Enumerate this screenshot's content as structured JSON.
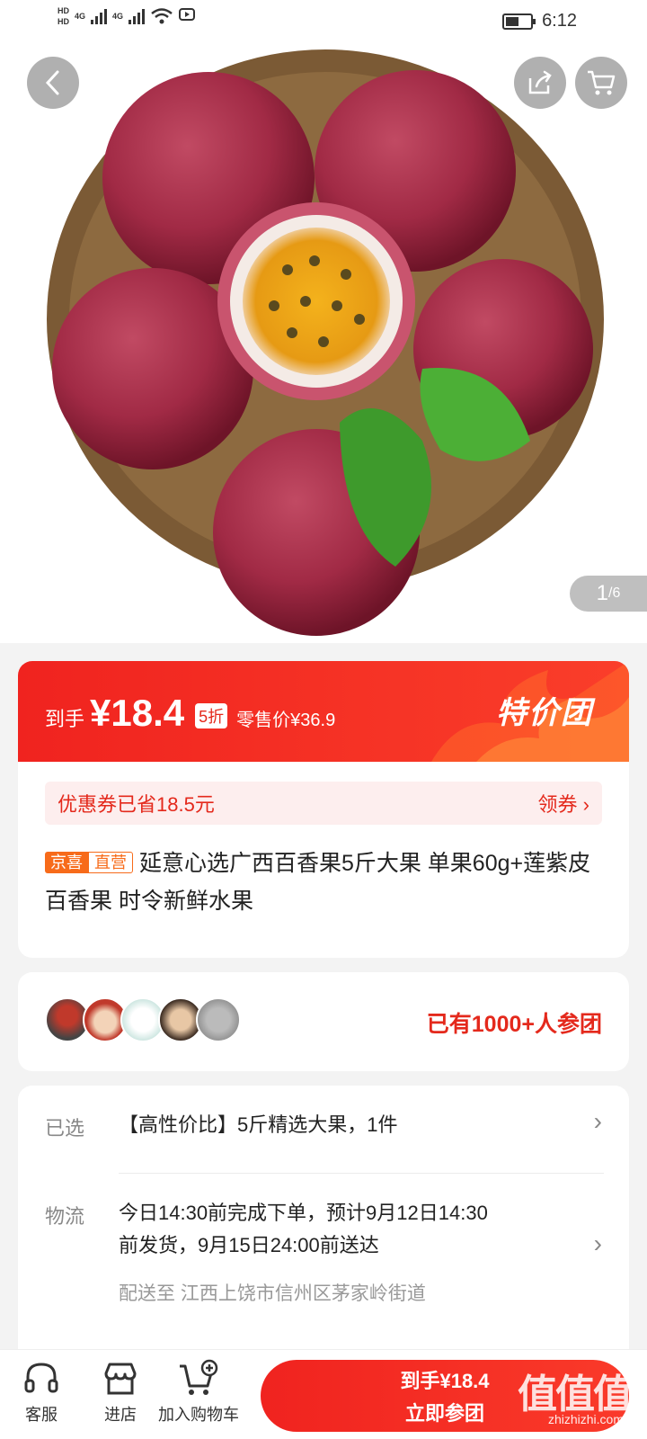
{
  "status_bar": {
    "hd1": "HD",
    "hd2": "HD",
    "net1": "4G",
    "net2": "4G",
    "time": "6:12"
  },
  "hero": {
    "image_counter_current": "1",
    "image_counter_total": "/6"
  },
  "price_band": {
    "label": "到手",
    "price": "¥18.4",
    "discount": "5折",
    "original_price": "零售价¥36.9",
    "badge": "特价团"
  },
  "coupon": {
    "text": "优惠券已省18.5元",
    "action": "领券"
  },
  "product": {
    "tag1": "京喜",
    "tag2": "直营",
    "title": "延意心选广西百香果5斤大果 单果60g+莲紫皮百香果 时令新鲜水果"
  },
  "group": {
    "text": "已有1000+人参团"
  },
  "selection": {
    "label": "已选",
    "value": "【高性价比】5斤精选大果，1件"
  },
  "logistics": {
    "label": "物流",
    "line1": "今日14:30前完成下单，预计9月12日14:30",
    "line2": "前发货，9月15日24:00前送达",
    "ship_to": "配送至  江西上饶市信州区茅家岭街道"
  },
  "bottom_bar": {
    "service": "客服",
    "store": "进店",
    "add_cart": "加入购物车",
    "buy_price": "到手¥18.4",
    "buy_label": "立即参团"
  },
  "watermark": {
    "main": "值值值",
    "sub": "zhizhizhi.com"
  },
  "colors": {
    "accent": "#f0231f",
    "tag_orange": "#f76b1a"
  }
}
